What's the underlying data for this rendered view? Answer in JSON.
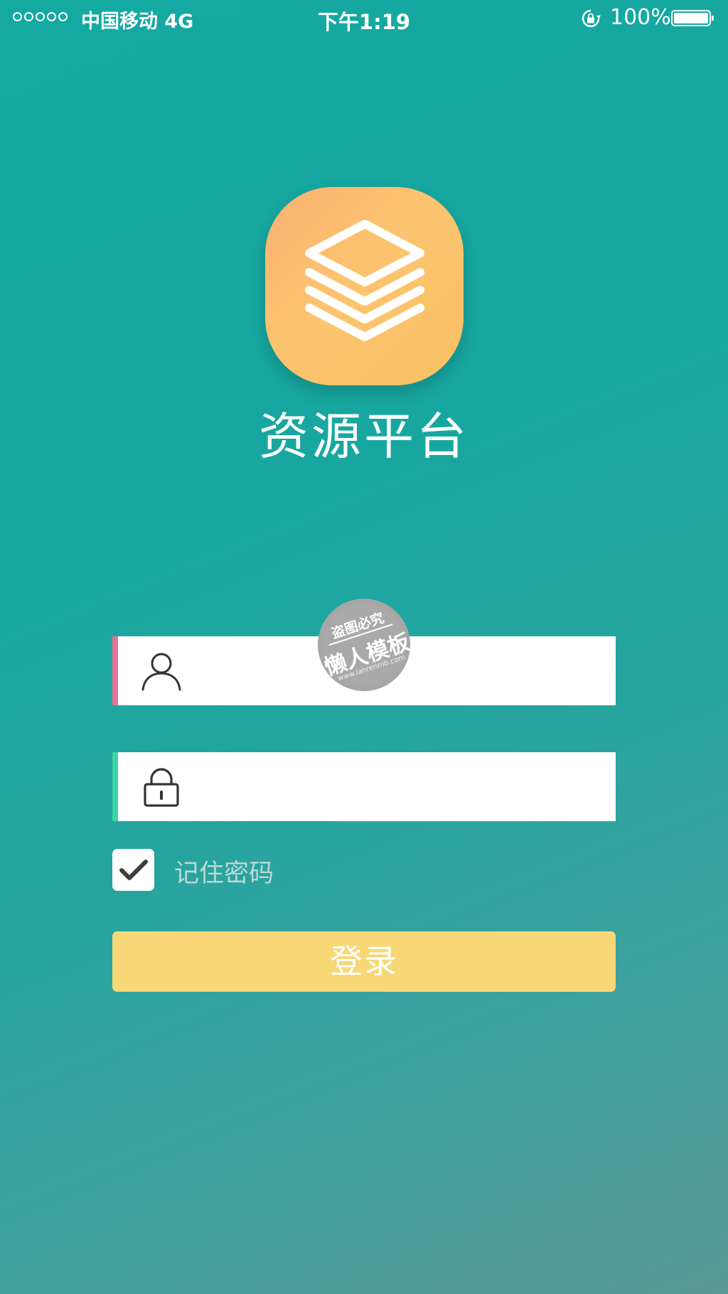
{
  "status_bar": {
    "carrier": "中国移动 4G",
    "time": "下午1:19",
    "battery_percent": "100%"
  },
  "app": {
    "title": "资源平台",
    "logo_icon": "layers-stack-icon"
  },
  "form": {
    "username": {
      "icon": "user-icon",
      "value": "",
      "placeholder": ""
    },
    "password": {
      "icon": "lock-icon",
      "value": "",
      "placeholder": ""
    },
    "remember": {
      "label": "记住密码",
      "checked": true
    },
    "login_label": "登录"
  },
  "watermark": {
    "top": "盗图必究",
    "main": "懒人模板",
    "url": "www.lanrenmb.com"
  },
  "colors": {
    "background_start": "#14a9a1",
    "background_end": "#5a9a98",
    "logo": "#fcc46f",
    "username_accent": "#ec6f94",
    "password_accent": "#3dd4a7",
    "login_button": "#f8d776"
  }
}
